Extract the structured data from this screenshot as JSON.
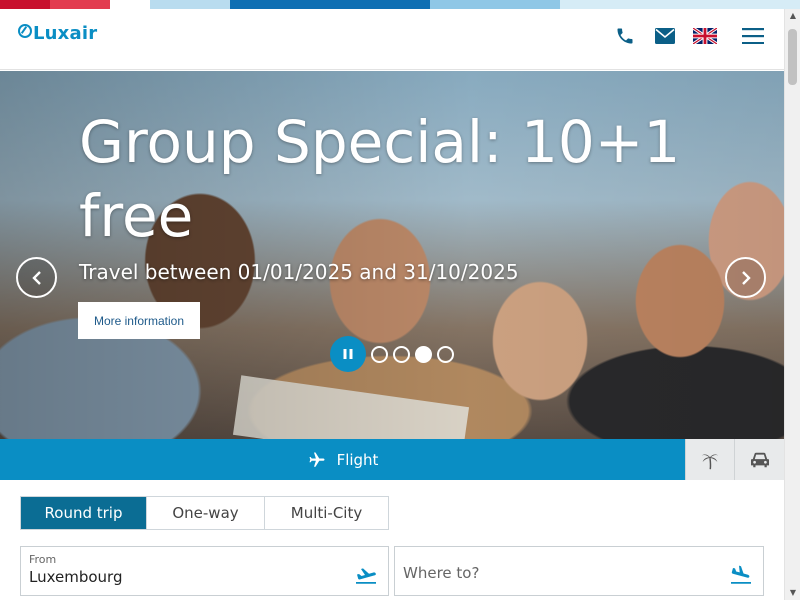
{
  "header": {
    "logo_text": "Luxair",
    "icons": [
      "phone-icon",
      "email-icon",
      "uk-flag-icon",
      "menu-icon"
    ]
  },
  "hero": {
    "title": "Group Special: 10+1 free",
    "subtitle": "Travel between 01/01/2025 and 31/10/2025",
    "cta_label": "More information",
    "slides_total": 4,
    "active_slide": 3
  },
  "booking": {
    "tabs": {
      "flight_label": "Flight",
      "holiday_icon": "palm-tree-icon",
      "car_icon": "car-icon"
    },
    "trip_types": [
      {
        "label": "Round trip",
        "active": true
      },
      {
        "label": "One-way",
        "active": false
      },
      {
        "label": "Multi-City",
        "active": false
      }
    ],
    "from": {
      "label": "From",
      "value": "Luxembourg"
    },
    "to": {
      "placeholder": "Where to?"
    }
  },
  "colors": {
    "brand": "#0a8ec4",
    "trip_active": "#0b6d94"
  }
}
